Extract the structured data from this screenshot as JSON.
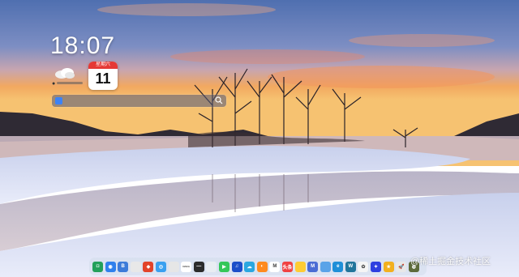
{
  "desktop": {
    "time": "18:07",
    "calendar": {
      "weekday": "星期六",
      "day": "11"
    },
    "search": {
      "placeholder": ""
    },
    "watermark": "@稀土掘金技术社区"
  },
  "dock": {
    "apps": [
      {
        "name": "finder",
        "color": "#22a05a",
        "glyph": "◘"
      },
      {
        "name": "chrome",
        "color": "#2f80ed",
        "glyph": "◉"
      },
      {
        "name": "bing",
        "color": "#3d7bd9",
        "glyph": "B"
      },
      {
        "name": "search",
        "color": "#e8e8e8",
        "glyph": ""
      },
      {
        "name": "gitlab",
        "color": "#e2432a",
        "glyph": "◆"
      },
      {
        "name": "browser",
        "color": "#3aa0f0",
        "glyph": "◎"
      },
      {
        "name": "mail",
        "color": "#e6e6e6",
        "glyph": ""
      },
      {
        "name": "naka",
        "color": "#ffffff",
        "glyph": "NAKA"
      },
      {
        "name": "terminal",
        "color": "#2b2b2b",
        "glyph": "—"
      },
      {
        "name": "monitor",
        "color": "#e9edf2",
        "glyph": ""
      },
      {
        "name": "play",
        "color": "#34c759",
        "glyph": "▶"
      },
      {
        "name": "music",
        "color": "#1c4ec9",
        "glyph": "♫"
      },
      {
        "name": "cloud",
        "color": "#2aa7e0",
        "glyph": "☁"
      },
      {
        "name": "orange-app",
        "color": "#ff8a1f",
        "glyph": "◐"
      },
      {
        "name": "gmail",
        "color": "#ffffff",
        "glyph": "M"
      },
      {
        "name": "toutiao",
        "color": "#f04142",
        "glyph": "头条"
      },
      {
        "name": "rainbow",
        "color": "#ffcc33",
        "glyph": ""
      },
      {
        "name": "mastodon",
        "color": "#4a6cd4",
        "glyph": "M"
      },
      {
        "name": "window",
        "color": "#59a3e8",
        "glyph": ""
      },
      {
        "name": "edge",
        "color": "#1f8fd8",
        "glyph": "e"
      },
      {
        "name": "wordpress",
        "color": "#21759b",
        "glyph": "W"
      },
      {
        "name": "photos",
        "color": "#f5f5f5",
        "glyph": "✿"
      },
      {
        "name": "baidu",
        "color": "#2e3fe0",
        "glyph": "✦"
      },
      {
        "name": "star",
        "color": "#f2b01e",
        "glyph": "★"
      },
      {
        "name": "rocket",
        "color": "#e8e8e8",
        "glyph": "🚀"
      },
      {
        "name": "globe",
        "color": "#5d6b3a",
        "glyph": "◍"
      }
    ]
  }
}
